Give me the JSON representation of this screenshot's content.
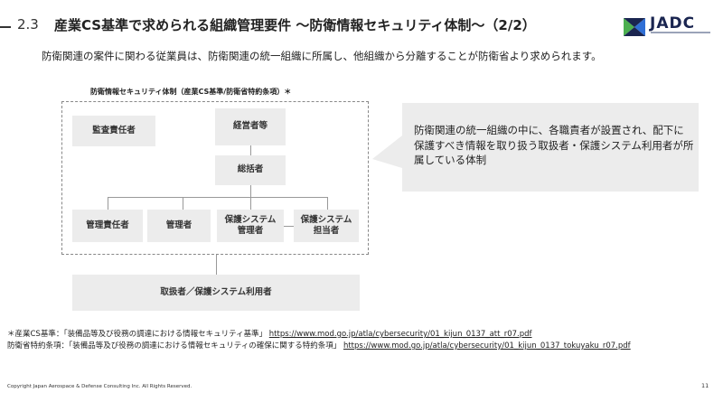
{
  "header": {
    "section_number": "2.3",
    "title": "産業CS基準で求められる組織管理要件 ～防衛情報セキュリティ体制～（2/2）"
  },
  "logo": {
    "text": "JADC",
    "colors": {
      "navy": "#1a2550",
      "green": "#4caf50",
      "blue": "#2f6fd6"
    }
  },
  "lead": "防衛関連の案件に関わる従業員は、防衛関連の統一組織に所属し、他組織から分離することが防衛省より求められます。",
  "diagram": {
    "caption": "防衛情報セキュリティ体制（産業CS基準/防衛省特約条項）＊",
    "boxes": {
      "audit": "監査責任者",
      "executive": "経営者等",
      "supervisor": "総括者",
      "manager_resp": "管理責任者",
      "manager": "管理者",
      "sys_manager": "保護システム\n管理者",
      "sys_operator": "保護システム\n担当者",
      "handlers": "取扱者／保護システム利用者"
    }
  },
  "callout": "防衛関連の統一組織の中に、各職責者が設置され、配下に保護すべき情報を取り扱う取扱者・保護システム利用者が所属している体制",
  "notes": {
    "cs_label": "＊産業CS基準：「装備品等及び役務の調達における情報セキュリティ基準」",
    "cs_url": "https://www.mod.go.jp/atla/cybersecurity/01_kijun_0137_att_r07.pdf",
    "clause_label": "防衛省特約条項：「装備品等及び役務の調達における情報セキュリティの確保に関する特約条項」",
    "clause_url": "https://www.mod.go.jp/atla/cybersecurity/01_kijun_0137_tokuyaku_r07.pdf"
  },
  "footer": {
    "copyright": "Copyright Japan Aerospace & Defense Consulting Inc. All Rights Reserved.",
    "page_number": "11"
  }
}
